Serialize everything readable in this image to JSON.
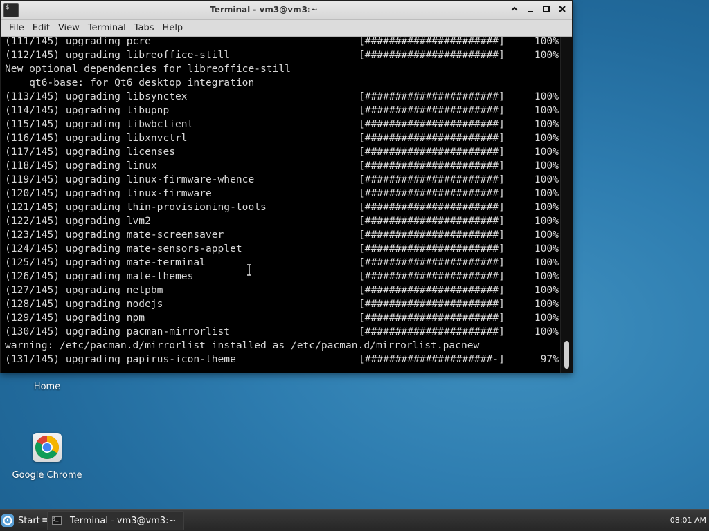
{
  "desktop": {
    "icons": [
      {
        "label": "Home",
        "icon": "home-folder-icon"
      },
      {
        "label": "Google Chrome",
        "icon": "chrome-icon"
      }
    ]
  },
  "window": {
    "title": "Terminal - vm3@vm3:~",
    "controls": [
      "chevron-up-icon",
      "minimize-icon",
      "maximize-icon",
      "close-icon"
    ]
  },
  "menu": [
    "File",
    "Edit",
    "View",
    "Terminal",
    "Tabs",
    "Help"
  ],
  "terminal": {
    "lines": [
      {
        "text": "(111/145) upgrading pcre",
        "bar": "[######################]",
        "pct": "100%"
      },
      {
        "text": "(112/145) upgrading libreoffice-still",
        "bar": "[######################]",
        "pct": "100%"
      },
      {
        "text": "New optional dependencies for libreoffice-still",
        "bar": "",
        "pct": ""
      },
      {
        "text": "    qt6-base: for Qt6 desktop integration",
        "bar": "",
        "pct": ""
      },
      {
        "text": "(113/145) upgrading libsynctex",
        "bar": "[######################]",
        "pct": "100%"
      },
      {
        "text": "(114/145) upgrading libupnp",
        "bar": "[######################]",
        "pct": "100%"
      },
      {
        "text": "(115/145) upgrading libwbclient",
        "bar": "[######################]",
        "pct": "100%"
      },
      {
        "text": "(116/145) upgrading libxnvctrl",
        "bar": "[######################]",
        "pct": "100%"
      },
      {
        "text": "(117/145) upgrading licenses",
        "bar": "[######################]",
        "pct": "100%"
      },
      {
        "text": "(118/145) upgrading linux",
        "bar": "[######################]",
        "pct": "100%"
      },
      {
        "text": "(119/145) upgrading linux-firmware-whence",
        "bar": "[######################]",
        "pct": "100%"
      },
      {
        "text": "(120/145) upgrading linux-firmware",
        "bar": "[######################]",
        "pct": "100%"
      },
      {
        "text": "(121/145) upgrading thin-provisioning-tools",
        "bar": "[######################]",
        "pct": "100%"
      },
      {
        "text": "(122/145) upgrading lvm2",
        "bar": "[######################]",
        "pct": "100%"
      },
      {
        "text": "(123/145) upgrading mate-screensaver",
        "bar": "[######################]",
        "pct": "100%"
      },
      {
        "text": "(124/145) upgrading mate-sensors-applet",
        "bar": "[######################]",
        "pct": "100%"
      },
      {
        "text": "(125/145) upgrading mate-terminal",
        "bar": "[######################]",
        "pct": "100%"
      },
      {
        "text": "(126/145) upgrading mate-themes",
        "bar": "[######################]",
        "pct": "100%"
      },
      {
        "text": "(127/145) upgrading netpbm",
        "bar": "[######################]",
        "pct": "100%"
      },
      {
        "text": "(128/145) upgrading nodejs",
        "bar": "[######################]",
        "pct": "100%"
      },
      {
        "text": "(129/145) upgrading npm",
        "bar": "[######################]",
        "pct": "100%"
      },
      {
        "text": "(130/145) upgrading pacman-mirrorlist",
        "bar": "[######################]",
        "pct": "100%"
      },
      {
        "text": "warning: /etc/pacman.d/mirrorlist installed as /etc/pacman.d/mirrorlist.pacnew",
        "bar": "",
        "pct": ""
      },
      {
        "text": "(131/145) upgrading papirus-icon-theme",
        "bar": "[#####################-]",
        "pct": "97%"
      }
    ]
  },
  "taskbar": {
    "start_label": "Start",
    "separator": "≡",
    "task_label": "Terminal - vm3@vm3:~",
    "clock": "08:01 AM"
  }
}
